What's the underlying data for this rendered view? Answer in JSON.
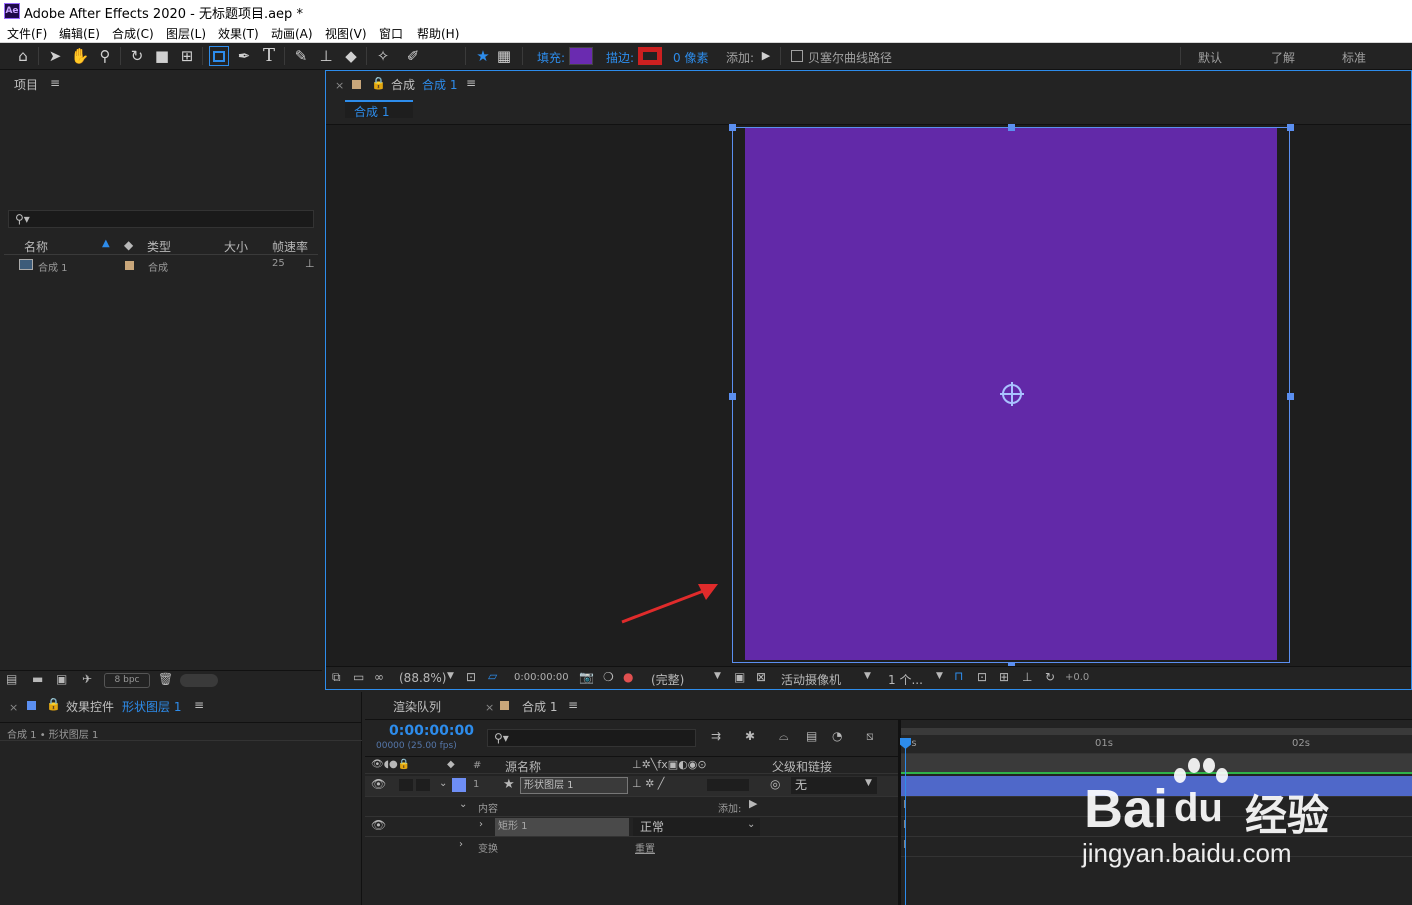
{
  "titlebar": {
    "icon": "Ae",
    "title": "Adobe After Effects 2020 - 无标题项目.aep *"
  },
  "menu": [
    "文件(F)",
    "编辑(E)",
    "合成(C)",
    "图层(L)",
    "效果(T)",
    "动画(A)",
    "视图(V)",
    "窗口",
    "帮助(H)"
  ],
  "toolbar": {
    "fill_label": "填充:",
    "stroke_label": "描边:",
    "stroke_width": "0 像素",
    "add_label": "添加:",
    "bezier_label": "贝塞尔曲线路径",
    "workspaces": [
      "默认",
      "了解",
      "标准"
    ],
    "fill_color": "#6a2bb0",
    "stroke_color": "#cc2020"
  },
  "project": {
    "title": "项目",
    "search_placeholder": "",
    "columns": [
      "名称",
      "类型",
      "大小",
      "帧速率"
    ],
    "items": [
      {
        "name": "合成 1",
        "type": "合成",
        "size": "",
        "fps": "25"
      }
    ],
    "bpc": "8 bpc"
  },
  "composition": {
    "tab_prefix": "合成",
    "tab_name": "合成 1",
    "subtab": "合成 1",
    "comp_color": "#6229a8",
    "footer": {
      "zoom": "(88.8%)",
      "timecode": "0:00:00:00",
      "quality": "(完整)",
      "camera": "活动摄像机",
      "views": "1 个...",
      "exposure": "+0.0"
    }
  },
  "effects": {
    "title": "效果控件",
    "layer": "形状图层 1",
    "breadcrumb": "合成 1 • 形状图层 1"
  },
  "render_queue": {
    "title": "渲染队列"
  },
  "timeline": {
    "tab": "合成 1",
    "timecode": "0:00:00:00",
    "fps_info": "00000 (25.00 fps)",
    "search_placeholder": "",
    "columns": {
      "num": "#",
      "source": "源名称",
      "parent": "父级和链接"
    },
    "layer": {
      "num": "1",
      "name": "形状图层 1",
      "parent": "无"
    },
    "contents_label": "内容",
    "add_label": "添加:",
    "rect_label": "矩形 1",
    "blend_mode": "正常",
    "transform_label": "变换",
    "reset_label": "重置",
    "ruler": [
      "0s",
      "01s",
      "02s"
    ]
  },
  "watermark": {
    "brand": "Bai",
    "brand2": "du",
    "brand_cn": "经验",
    "url": "jingyan.baidu.com"
  }
}
